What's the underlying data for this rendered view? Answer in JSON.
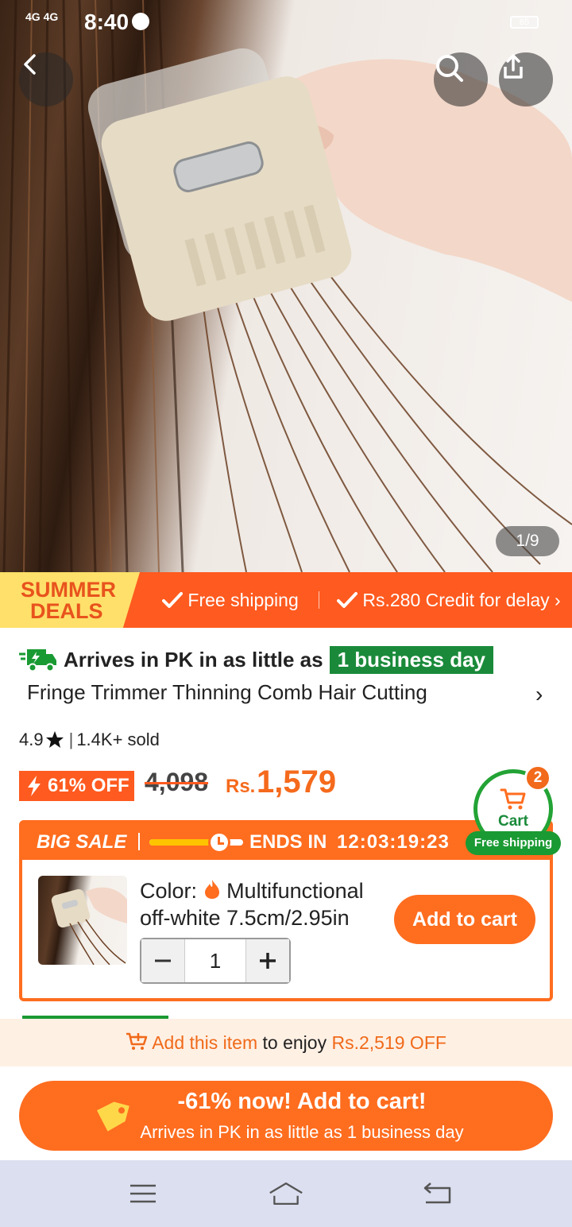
{
  "status_bar": {
    "network": "4G 4G",
    "time": "8:40",
    "battery": "85"
  },
  "hero": {
    "pager": "1/9"
  },
  "promo": {
    "summer_line1": "SUMMER",
    "summer_line2": "DEALS",
    "free_shipping": "Free shipping",
    "credit": "Rs.280 Credit for delay"
  },
  "arrival": {
    "text": "Arrives in PK in as little as",
    "days": "1 business day"
  },
  "product": {
    "title": "Fringe Trimmer Thinning Comb Hair Cutting",
    "rating": "4.9",
    "sold": "1.4K+ sold",
    "off": "61% OFF",
    "old_price": "4,098",
    "currency": "Rs.",
    "price": "1,579"
  },
  "cart": {
    "label": "Cart",
    "count": "2",
    "free_shipping": "Free shipping"
  },
  "sale": {
    "title": "BIG SALE",
    "ends_label": "ENDS IN",
    "timer": "12:03:19:23",
    "progress_fraction": 0.7,
    "color_label": "Color:",
    "color_value": "Multifunctional off-white 7.5cm/2.95in",
    "add_to_cart": "Add to cart",
    "quantity": "1"
  },
  "bundle": {
    "highlight": "Add this item",
    "middle": "to enjoy",
    "amount": "Rs.2,519 OFF"
  },
  "cta": {
    "line1": "-61% now! Add to cart!",
    "line2": "Arrives in PK in as little as 1 business day"
  },
  "colors": {
    "accent": "#ff6d1f",
    "green": "#1a8a3a",
    "badge_bg": "#ffe06a"
  },
  "icons": [
    "back-icon",
    "search-icon",
    "share-icon",
    "check-icon",
    "truck-icon",
    "star-icon",
    "lightning-icon",
    "clock-icon",
    "flame-icon",
    "cart-icon",
    "tag-icon",
    "menu-icon",
    "home-icon",
    "return-icon"
  ]
}
